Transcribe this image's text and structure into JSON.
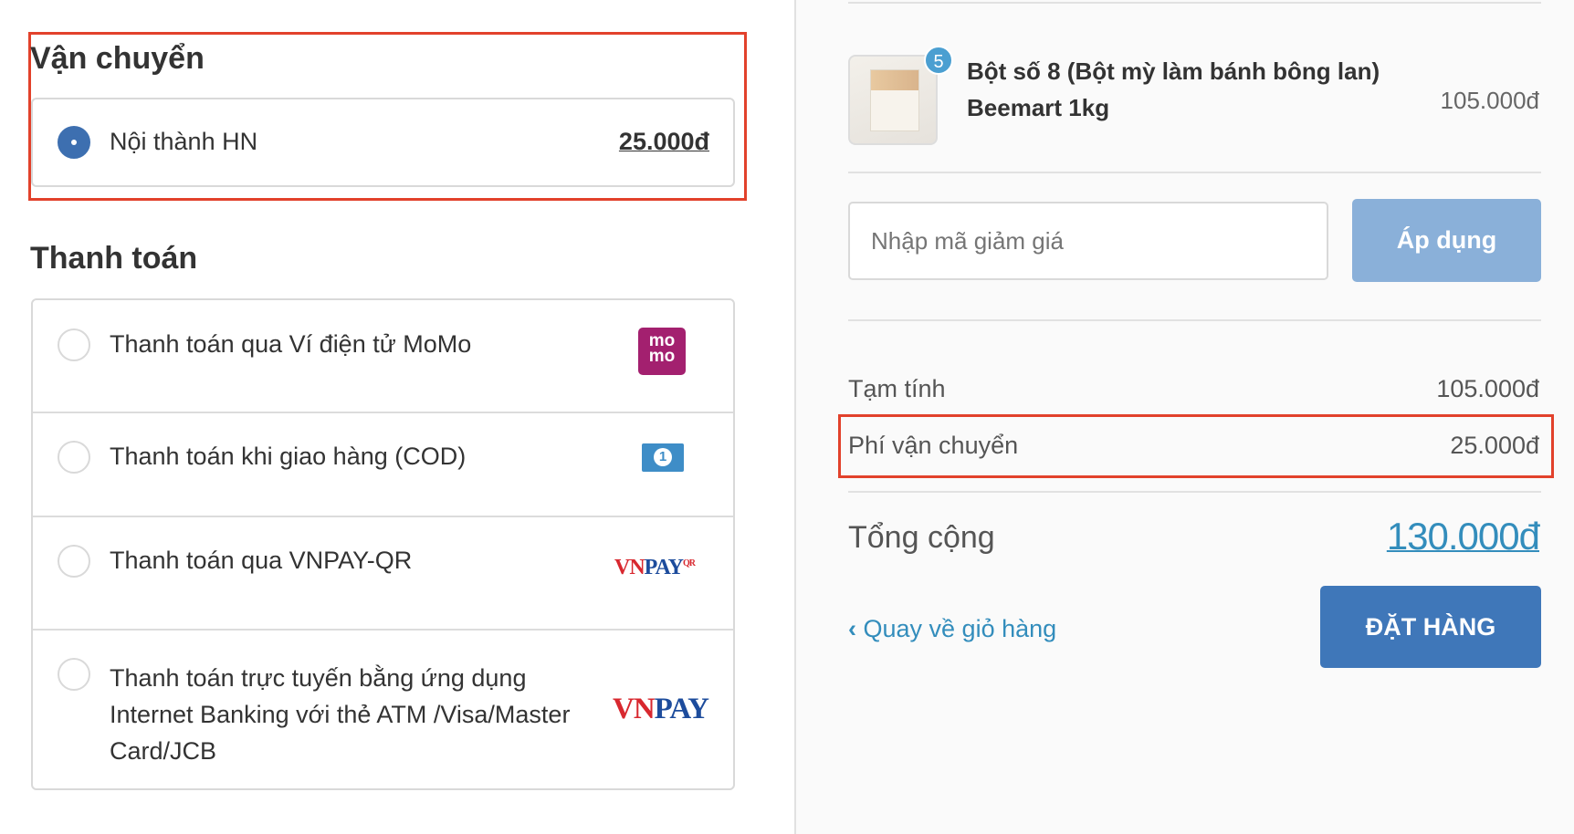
{
  "shipping": {
    "title": "Vận chuyển",
    "option": {
      "label": "Nội thành HN",
      "price": "25.000đ",
      "selected": true
    }
  },
  "payment": {
    "title": "Thanh toán",
    "methods": [
      {
        "label": "Thanh toán qua Ví điện tử MoMo",
        "icon": "momo-logo",
        "logo_text": "mo mo"
      },
      {
        "label": "Thanh toán khi giao hàng (COD)",
        "icon": "cash-icon",
        "logo_text": "1"
      },
      {
        "label": "Thanh toán qua VNPAY-QR",
        "icon": "vnpay-qr-logo",
        "logo_text": "VNPAY QR"
      },
      {
        "label": "Thanh toán trực tuyến bằng ứng dụng Internet Banking với thẻ ATM /Visa/Master Card/JCB",
        "icon": "vnpay-logo",
        "logo_text": "VNPAY"
      }
    ]
  },
  "order": {
    "product": {
      "name": "Bột số 8 (Bột mỳ làm bánh bông lan) Beemart 1kg",
      "quantity": "5",
      "price": "105.000đ"
    },
    "discount": {
      "placeholder": "Nhập mã giảm giá",
      "apply": "Áp dụng"
    },
    "subtotal": {
      "label": "Tạm tính",
      "value": "105.000đ"
    },
    "shipping_fee": {
      "label": "Phí vận chuyển",
      "value": "25.000đ"
    },
    "total": {
      "label": "Tổng cộng",
      "value": "130.000đ"
    },
    "back": "Quay về giỏ hàng",
    "submit": "ĐẶT HÀNG"
  },
  "colors": {
    "accent": "#3d6fb0",
    "link": "#338dbc",
    "highlight": "#e2412b"
  }
}
